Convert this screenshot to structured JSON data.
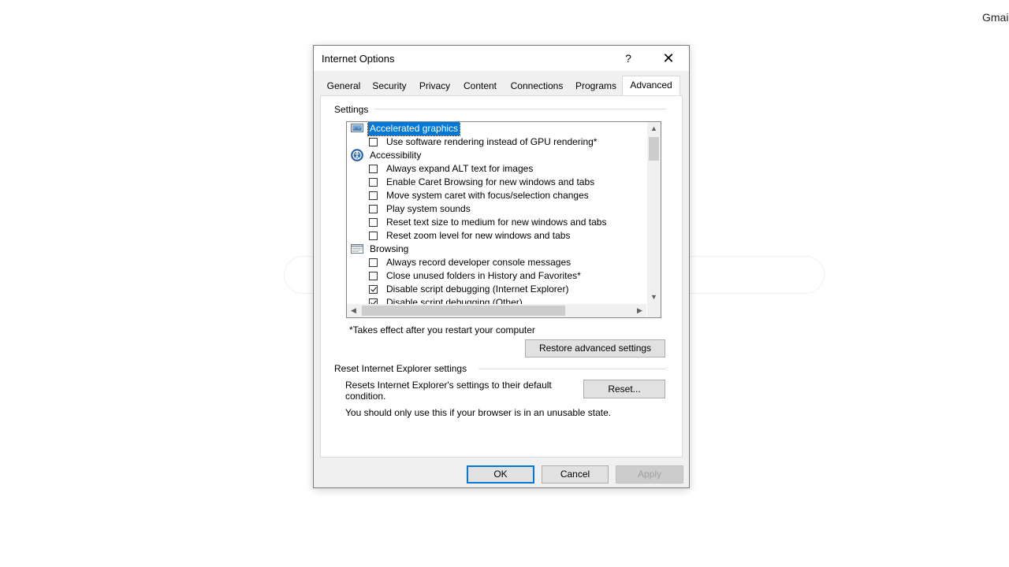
{
  "background": {
    "corner_text": "Gmai"
  },
  "dialog": {
    "title": "Internet Options",
    "help_glyph": "?",
    "close_glyph": "✕",
    "tabs": [
      {
        "label": "General",
        "active": false
      },
      {
        "label": "Security",
        "active": false
      },
      {
        "label": "Privacy",
        "active": false
      },
      {
        "label": "Content",
        "active": false
      },
      {
        "label": "Connections",
        "active": false
      },
      {
        "label": "Programs",
        "active": false
      },
      {
        "label": "Advanced",
        "active": true
      }
    ],
    "settings": {
      "group_label": "Settings",
      "items": [
        {
          "kind": "category",
          "label": "Accelerated graphics",
          "icon": "monitor-icon",
          "selected": true
        },
        {
          "kind": "option",
          "label": "Use software rendering instead of GPU rendering*",
          "checked": false
        },
        {
          "kind": "category",
          "label": "Accessibility",
          "icon": "accessibility-icon",
          "selected": false
        },
        {
          "kind": "option",
          "label": "Always expand ALT text for images",
          "checked": false
        },
        {
          "kind": "option",
          "label": "Enable Caret Browsing for new windows and tabs",
          "checked": false
        },
        {
          "kind": "option",
          "label": "Move system caret with focus/selection changes",
          "checked": false
        },
        {
          "kind": "option",
          "label": "Play system sounds",
          "checked": false
        },
        {
          "kind": "option",
          "label": "Reset text size to medium for new windows and tabs",
          "checked": false
        },
        {
          "kind": "option",
          "label": "Reset zoom level for new windows and tabs",
          "checked": false
        },
        {
          "kind": "category",
          "label": "Browsing",
          "icon": "browser-window-icon",
          "selected": false
        },
        {
          "kind": "option",
          "label": "Always record developer console messages",
          "checked": false
        },
        {
          "kind": "option",
          "label": "Close unused folders in History and Favorites*",
          "checked": false
        },
        {
          "kind": "option",
          "label": "Disable script debugging (Internet Explorer)",
          "checked": true
        },
        {
          "kind": "option",
          "label": "Disable script debugging (Other)",
          "checked": true
        }
      ],
      "restart_note": "*Takes effect after you restart your computer",
      "restore_button": "Restore advanced settings"
    },
    "reset_section": {
      "group_label": "Reset Internet Explorer settings",
      "description_line1": "Resets Internet Explorer's settings to their default",
      "description_line2": "condition.",
      "reset_button": "Reset...",
      "warning": "You should only use this if your browser is in an unusable state."
    },
    "footer": {
      "ok": "OK",
      "cancel": "Cancel",
      "apply": "Apply"
    }
  }
}
